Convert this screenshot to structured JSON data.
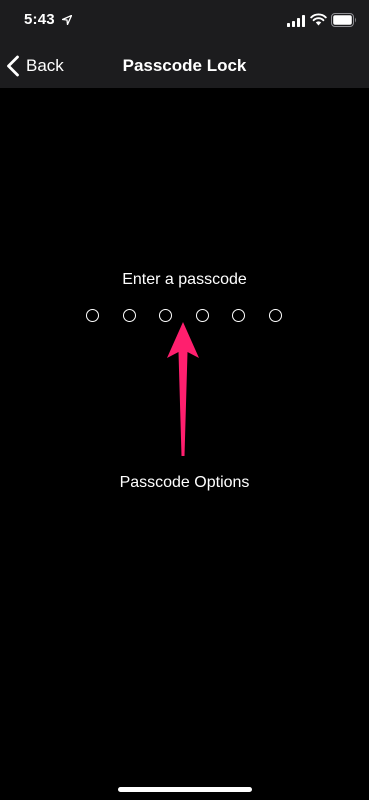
{
  "status_bar": {
    "time": "5:43",
    "icons": [
      "location-icon",
      "signal-icon",
      "wifi-icon",
      "battery-icon"
    ]
  },
  "nav": {
    "back_label": "Back",
    "title": "Passcode Lock"
  },
  "passcode": {
    "prompt": "Enter a passcode",
    "digits_total": 6,
    "digits_entered": 0,
    "options_label": "Passcode Options"
  },
  "annotation": {
    "arrow_color": "#ff1f6e"
  },
  "colors": {
    "background": "#000000",
    "bar_background": "#1c1c1e",
    "text": "#ffffff"
  }
}
